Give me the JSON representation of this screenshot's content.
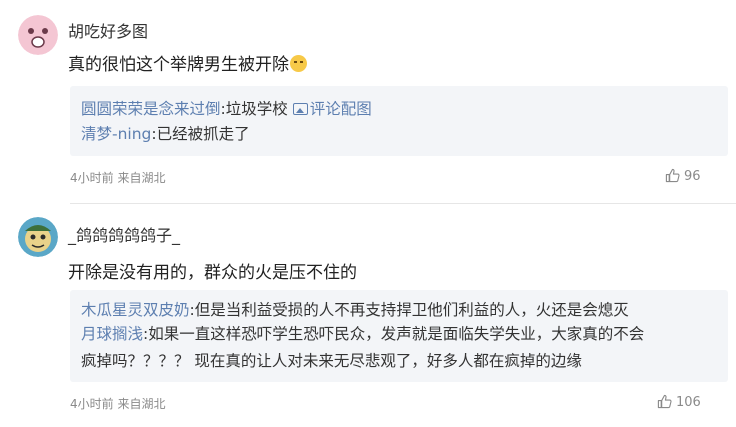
{
  "comments": [
    {
      "username": "胡吃好多图",
      "text": "真的很怕这个举牌男生被开除",
      "emoji_icon": "crying-face-emoji",
      "replies": [
        {
          "name": "圆圆荣荣是念来过倒",
          "text": ":垃圾学校",
          "pic_label": "评论配图"
        },
        {
          "name": "清梦-ning",
          "text": ":已经被抓走了"
        }
      ],
      "meta": "4小时前 来自湖北",
      "likes": "96"
    },
    {
      "username": "_鸽鸽鸽鸽鸽子_",
      "text": "开除是没有用的，群众的火是压不住的",
      "replies": [
        {
          "name": "木瓜星灵双皮奶",
          "text": ":但是当利益受损的人不再支持捍卫他们利益的人，火还是会熄灭"
        },
        {
          "name": "月球搁浅",
          "text": ":如果一直这样恐吓学生恐吓民众，发声就是面临失学失业，大家真的不会",
          "continuation": "疯掉吗？？？？ 现在真的让人对未来无尽悲观了，好多人都在疯掉的边缘"
        }
      ],
      "meta": "4小时前 来自湖北",
      "likes": "106"
    }
  ],
  "colors": {
    "link": "#5d7fb0",
    "reply_bg": "#f3f5f8",
    "meta": "#8a8a8a"
  }
}
